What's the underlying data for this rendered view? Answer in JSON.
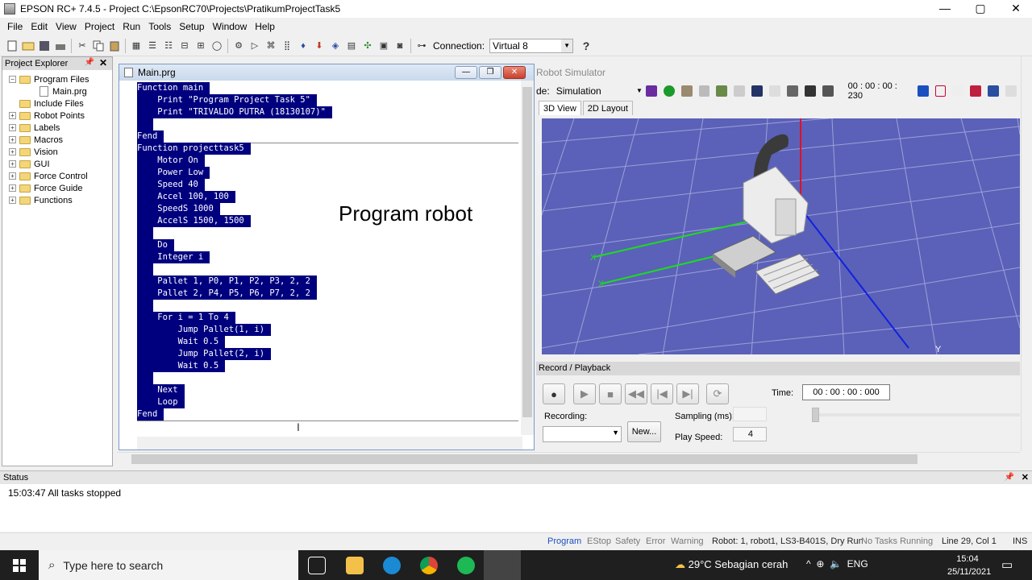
{
  "window": {
    "title": "EPSON RC+ 7.4.5 - Project C:\\EpsonRC70\\Projects\\PratikumProjectTask5",
    "min": "—",
    "max": "▢",
    "close": "✕"
  },
  "menu": [
    "File",
    "Edit",
    "View",
    "Project",
    "Run",
    "Tools",
    "Setup",
    "Window",
    "Help"
  ],
  "toolbar": {
    "connection_label": "Connection:",
    "connection_value": "Virtual 8",
    "help": "?"
  },
  "explorer": {
    "title": "Project Explorer",
    "items": [
      "Program Files",
      "Main.prg",
      "Include Files",
      "Robot Points",
      "Labels",
      "Macros",
      "Vision",
      "GUI",
      "Force Control",
      "Force Guide",
      "Functions"
    ]
  },
  "editor": {
    "title": "Main.prg",
    "lines": [
      "Function main",
      "    Print \"Program Project Task 5\"",
      "    Print \"TRIVALDO PUTRA (18130107)\"",
      "",
      "Fend",
      "Function projecttask5",
      "    Motor On",
      "    Power Low",
      "    Speed 40",
      "    Accel 100, 100",
      "    SpeedS 1000",
      "    AccelS 1500, 1500",
      "",
      "    Do",
      "    Integer i",
      "",
      "    Pallet 1, P0, P1, P2, P3, 2, 2",
      "    Pallet 2, P4, P5, P6, P7, 2, 2",
      "",
      "    For i = 1 To 4",
      "        Jump Pallet(1, i)",
      "        Wait 0.5",
      "        Jump Pallet(2, i)",
      "        Wait 0.5",
      "",
      "    Next",
      "    Loop",
      "Fend"
    ]
  },
  "overlay_text": "Program robot",
  "simulator": {
    "title": "Robot Simulator",
    "mode_label": "de:",
    "mode_value": "Simulation",
    "time": "00 : 00 : 00 : 230",
    "tabs": [
      "3D View",
      "2D Layout"
    ],
    "axis_x": "X",
    "axis_y": "Y",
    "record_header": "Record / Playback",
    "time_label": "Time:",
    "time_value": "00 : 00 : 00 : 000",
    "recording_label": "Recording:",
    "new_button": "New...",
    "sampling_label": "Sampling (ms):",
    "play_speed_label": "Play Speed:",
    "play_speed_value": "4"
  },
  "status": {
    "title": "Status",
    "message": "15:03:47 All tasks stopped"
  },
  "statusbar": {
    "program": "Program",
    "estop": "EStop",
    "safety": "Safety",
    "error": "Error",
    "warning": "Warning",
    "robot": "Robot: 1, robot1, LS3-B401S, Dry Run",
    "tasks": "No Tasks Running",
    "position": "Line 29, Col 1",
    "ins": "INS"
  },
  "taskbar": {
    "search": "Type here to search",
    "weather": "29°C  Sebagian cerah",
    "lang": "ENG",
    "time": "15:04",
    "date": "25/11/2021"
  },
  "colors": {
    "selection": "#00007f",
    "viewport_floor": "#5b61b8",
    "accent_blue": "#0078d7"
  }
}
